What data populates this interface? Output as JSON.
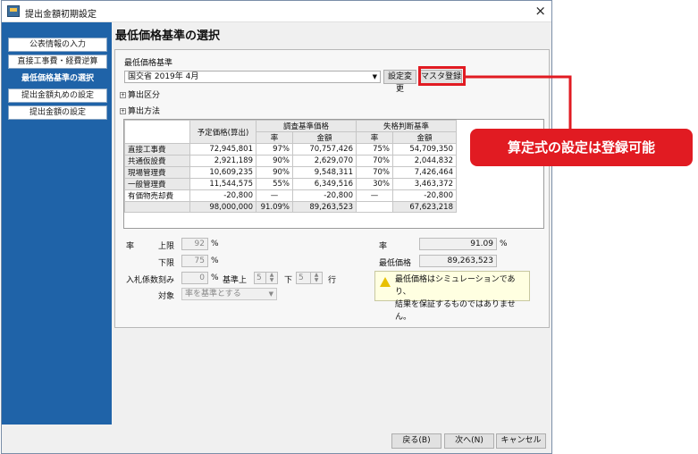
{
  "window": {
    "title": "提出金額初期設定",
    "close_icon": "×"
  },
  "sidebar": {
    "items": [
      {
        "label": "公表情報の入力"
      },
      {
        "label": "直接工事費・経費逆算"
      },
      {
        "label": "最低価格基準の選択"
      },
      {
        "label": "提出金額丸めの設定"
      },
      {
        "label": "提出金額の設定"
      }
    ]
  },
  "page": {
    "title": "最低価格基準の選択"
  },
  "criteria": {
    "label": "最低価格基準",
    "selected": "国交省 2019年 4月",
    "change_button": "設定変更",
    "master_button": "マスタ登録"
  },
  "expanders": {
    "calc_division": "算出区分",
    "calc_method": "算出方法",
    "plus_icon": "⊞"
  },
  "table": {
    "headers": {
      "planned": "予定価格(算出)",
      "survey": "調査基準価格",
      "fail": "失格判断基準",
      "rate": "率",
      "amount": "金額"
    },
    "rows": [
      {
        "name": "直接工事費",
        "planned": "72,945,801",
        "srate": "97%",
        "samount": "70,757,426",
        "frate": "75%",
        "famount": "54,709,350"
      },
      {
        "name": "共通仮設費",
        "planned": "2,921,189",
        "srate": "90%",
        "samount": "2,629,070",
        "frate": "70%",
        "famount": "2,044,832"
      },
      {
        "name": "現場管理費",
        "planned": "10,609,235",
        "srate": "90%",
        "samount": "9,548,311",
        "frate": "70%",
        "famount": "7,426,464"
      },
      {
        "name": "一般管理費",
        "planned": "11,544,575",
        "srate": "55%",
        "samount": "6,349,516",
        "frate": "30%",
        "famount": "3,463,372"
      },
      {
        "name": "有価物売却費",
        "planned": "-20,800",
        "srate": "—",
        "samount": "-20,800",
        "frate": "—",
        "famount": "-20,800"
      },
      {
        "name": "",
        "planned": "98,000,000",
        "srate": "91.09%",
        "samount": "89,263,523",
        "frate": "",
        "famount": "67,623,218"
      }
    ]
  },
  "limits": {
    "rate_label": "率",
    "upper_label": "上限",
    "upper_value": "92",
    "lower_label": "下限",
    "lower_value": "75",
    "percent": "%"
  },
  "bid": {
    "label": "入札係数刻み",
    "value": "0",
    "percent": "%",
    "base_label": "基準上",
    "base_value": "5",
    "down_label": "下",
    "down_value": "5",
    "row_label": "行",
    "target_label": "対象",
    "target_value": "率を基準とする"
  },
  "result": {
    "rate_label": "率",
    "rate_value": "91.09",
    "percent": "%",
    "min_label": "最低価格",
    "min_value": "89,263,523"
  },
  "notice": {
    "line1": "最低価格はシミュレーションであり、",
    "line2": "結果を保証するものではありません。"
  },
  "footer": {
    "back": "戻る(B)",
    "next": "次へ(N)",
    "cancel": "キャンセル"
  },
  "callout": {
    "text": "算定式の設定は登録可能"
  },
  "colors": {
    "sidebar": "#1f63a8",
    "callout": "#e11b22"
  }
}
